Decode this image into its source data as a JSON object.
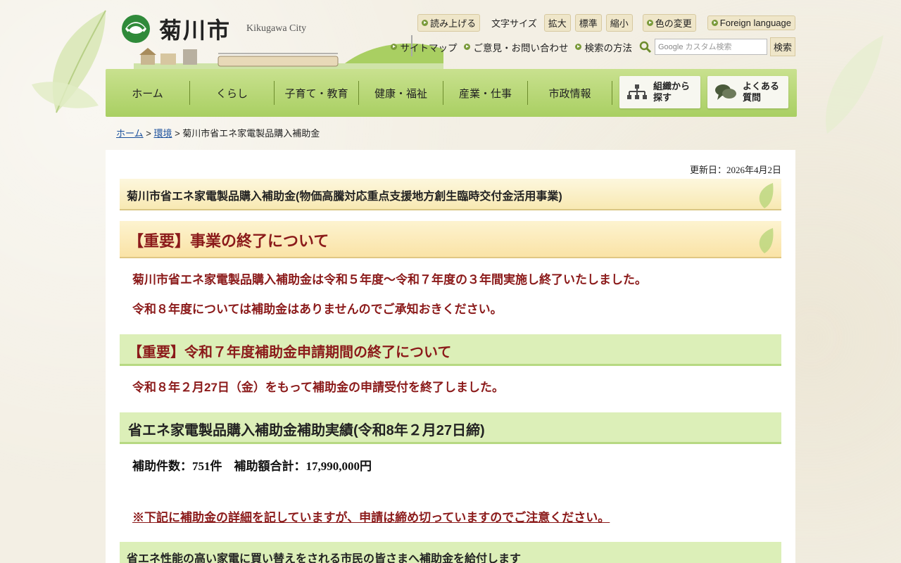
{
  "header": {
    "logo_text": "菊川市",
    "logo_en": "Kikugawa City"
  },
  "tools": {
    "read_aloud": "読み上げる",
    "font_size_label": "文字サイズ",
    "font_large": "拡大",
    "font_standard": "標準",
    "font_small": "縮小",
    "color_change": "色の変更",
    "foreign_language": "Foreign language",
    "sitemap": "サイトマップ",
    "opinion": "ご意見・お問い合わせ",
    "search_method": "検索の方法",
    "search_placeholder": "カスタム検索",
    "search_logo": "Google",
    "search_button": "検索"
  },
  "nav": {
    "items": [
      "ホーム",
      "くらし",
      "子育て・教育",
      "健康・福祉",
      "産業・仕事",
      "市政情報"
    ],
    "org_search_line1": "組織から",
    "org_search_line2": "探す",
    "faq_line1": "よくある",
    "faq_line2": "質問"
  },
  "breadcrumb": {
    "home": "ホーム",
    "sep1": " > ",
    "env": "環境",
    "sep2": " > ",
    "current": "菊川市省エネ家電製品購入補助金"
  },
  "main": {
    "updated": "更新日：2026年4月2日",
    "title": "菊川市省エネ家電製品購入補助金(物価高騰対応重点支援地方創生臨時交付金活用事業)",
    "important_heading": "【重要】事業の終了について",
    "para1": "菊川市省エネ家電製品購入補助金は令和５年度〜令和７年度の３年間実施し終了いたしました。",
    "para2": "令和８年度については補助金はありませんのでご承知おきください。",
    "deadline_heading": "【重要】令和７年度補助金申請期間の終了について",
    "para3": "令和８年２月27日（金）をもって補助金の申請受付を終了しました。",
    "results_heading": "省エネ家電製品購入補助金補助実績(令和8年２月27日締)",
    "stats": "補助件数：751件　補助額合計：17,990,000円",
    "notice": "※下記に補助金の詳細を記していますが、申請は締め切っていますのでご注意ください。",
    "subheading": "省エネ性能の高い家電に買い替えをされる市民の皆さまへ補助金を給付します"
  }
}
